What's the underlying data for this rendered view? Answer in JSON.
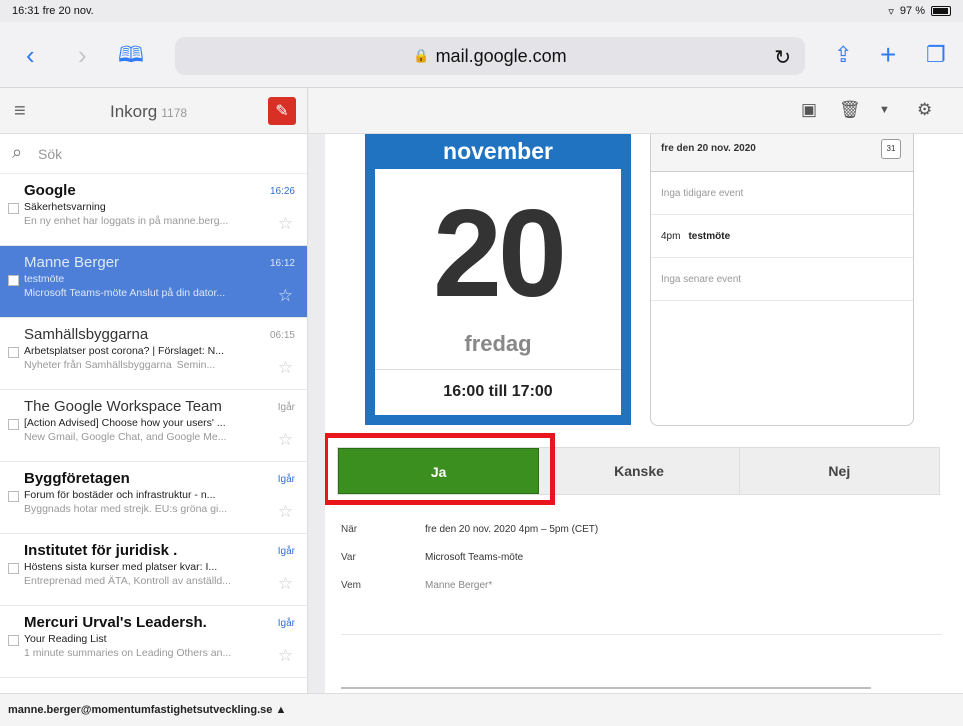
{
  "status": {
    "time_date": "16:31  fre 20 nov.",
    "battery": "97 %"
  },
  "browser": {
    "url": "mail.google.com"
  },
  "sidebar": {
    "title": "Inkorg",
    "count": "1178",
    "search_placeholder": "Sök",
    "emails": [
      {
        "from": "Google",
        "time": "16:26",
        "subject": "Säkerhetsvarning",
        "snippet": "En ny enhet har loggats in på manne.berg...",
        "unread": true,
        "selected": false
      },
      {
        "from": "Manne Berger",
        "time": "16:12",
        "subject": "testmöte",
        "snippet": "Microsoft Teams-möte Anslut på din dator...",
        "unread": false,
        "selected": true
      },
      {
        "from": "Samhällsbyggarna",
        "time": "06:15",
        "subject": "Arbetsplatser post corona? | Förslaget: N...",
        "snippet": "Nyheter från Samhällsbyggarna  Semin...",
        "unread": false,
        "selected": false
      },
      {
        "from": "The Google Workspace Team",
        "time": "Igår",
        "subject": "[Action Advised] Choose how your users' ...",
        "snippet": "New Gmail, Google Chat, and Google Me...",
        "unread": false,
        "selected": false
      },
      {
        "from": "Byggföretagen",
        "time": "Igår",
        "subject": "Forum för bostäder och infrastruktur - n...",
        "snippet": "Byggnads hotar med strejk. EU:s gröna gi...",
        "unread": true,
        "selected": false
      },
      {
        "from": "Institutet för juridisk .",
        "time": "Igår",
        "subject": "Höstens sista kurser med platser kvar: I...",
        "snippet": "Entreprenad med ÄTA, Kontroll av anställd...",
        "unread": true,
        "selected": false
      },
      {
        "from": "Mercuri Urval's Leadersh.",
        "time": "Igår",
        "subject": "Your Reading List",
        "snippet": "1 minute summaries on Leading Others an...",
        "unread": true,
        "selected": false
      }
    ]
  },
  "footer": {
    "account": "manne.berger@momentumfastighetsutveckling.se ▲"
  },
  "event": {
    "month": "november",
    "day": "20",
    "weekday": "fredag",
    "time_range": "16:00 till 17:00",
    "agenda": {
      "date": "fre den 20 nov. 2020",
      "cal_icon": "31",
      "before": "Inga tidigare event",
      "event_time": "4pm",
      "event_title": "testmöte",
      "after": "Inga senare event"
    },
    "rsvp": {
      "yes": "Ja",
      "maybe": "Kanske",
      "no": "Nej"
    },
    "details": {
      "when_label": "När",
      "when": "fre den 20 nov. 2020 4pm – 5pm (CET)",
      "where_label": "Var",
      "where": "Microsoft Teams-möte",
      "who_label": "Vem",
      "who": "Manne Berger*"
    }
  },
  "colors": {
    "selected": "#4d7fd8",
    "yes_button": "#3a8f1f",
    "calendar_blue": "#1f73c1",
    "highlight": "#e8151c"
  }
}
